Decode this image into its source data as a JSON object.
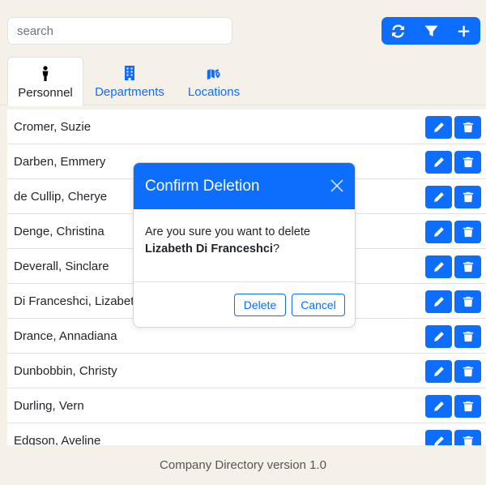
{
  "search": {
    "placeholder": "search",
    "value": ""
  },
  "toolbar": {
    "buttons": [
      {
        "icon": "refresh-icon"
      },
      {
        "icon": "filter-icon"
      },
      {
        "icon": "plus-icon"
      }
    ]
  },
  "tabs": [
    {
      "label": "Personnel",
      "icon": "person-icon",
      "active": true
    },
    {
      "label": "Departments",
      "icon": "building-icon",
      "active": false
    },
    {
      "label": "Locations",
      "icon": "map-location-icon",
      "active": false
    }
  ],
  "personnel": [
    "Cromer, Suzie",
    "Darben, Emmery",
    "de Cullip, Cherye",
    "Denge, Christina",
    "Deverall, Sinclare",
    "Di Franceshci, Lizabeth",
    "Drance, Annadiana",
    "Dunbobbin, Christy",
    "Durling, Vern",
    "Edgson, Aveline"
  ],
  "modal": {
    "title": "Confirm Deletion",
    "message_prefix": "Are you sure you want to delete",
    "target_name": "Lizabeth Di Franceshci",
    "message_suffix": "?",
    "delete_label": "Delete",
    "cancel_label": "Cancel"
  },
  "footer": {
    "text": "Company Directory version 1.0"
  },
  "colors": {
    "accent": "#0d6efd",
    "background": "#f5f1e8"
  }
}
